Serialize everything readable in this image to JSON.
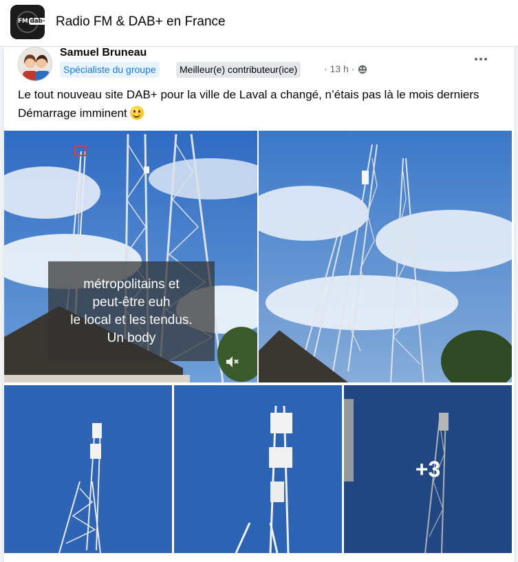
{
  "group": {
    "title": "Radio FM & DAB+ en France",
    "logo_text_fm": "FM",
    "logo_text_dab": "dab+"
  },
  "post": {
    "author": "Samuel Bruneau",
    "badge_specialist": "Spécialiste du groupe",
    "badge_contributor": "Meilleur(e) contributeur(ice)",
    "time": "· 13 h ·",
    "text": "Le tout nouveau site DAB+  pour la ville de Laval a changé, n’étais pas là le mois derniers Démarrage imminent",
    "icons": {
      "more": "more-options-icon",
      "privacy": "group-privacy-icon",
      "emoji": "smiling-emoji-icon",
      "mute": "speaker-muted-icon"
    }
  },
  "photos": {
    "video_caption": [
      "métropolitains et",
      "peut-être euh",
      "le local et les tendus.",
      "Un body"
    ],
    "more_count": "+3"
  },
  "colors": {
    "sky": "#3f77c6",
    "accent": "#1877f2",
    "badge_specialist_bg": "#e7f3ff",
    "badge_contrib_bg": "#e4e6eb"
  }
}
